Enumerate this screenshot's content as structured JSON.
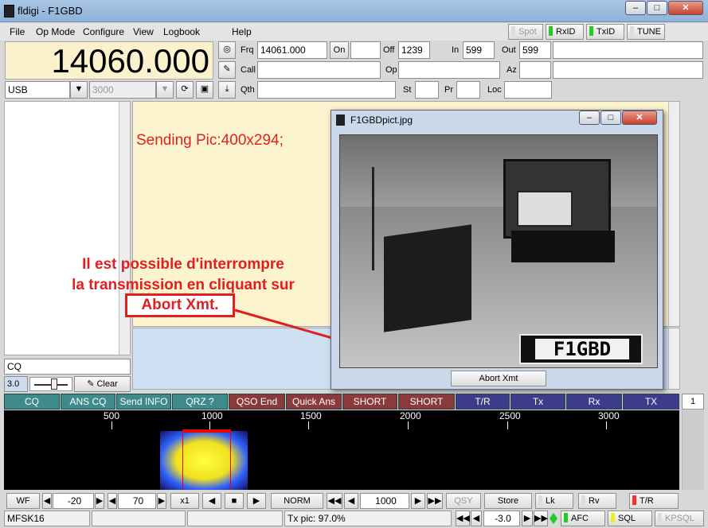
{
  "window": {
    "title": "fldigi - F1GBD"
  },
  "menu": {
    "file": "File",
    "opmode": "Op Mode",
    "configure": "Configure",
    "view": "View",
    "logbook": "Logbook",
    "help": "Help"
  },
  "indicators": {
    "spot": "Spot",
    "rxid": "RxID",
    "txid": "TxID",
    "tune": "TUNE"
  },
  "frequency_display": "14060.000",
  "mode_select": "USB",
  "bandwidth_select": "3000",
  "log": {
    "frq_label": "Frq",
    "frq_value": "14061.000",
    "on_label": "On",
    "off_label": "Off",
    "off_value": "1239",
    "in_label": "In",
    "in_value": "599",
    "out_label": "Out",
    "out_value": "599",
    "call_label": "Call",
    "op_label": "Op",
    "az_label": "Az",
    "qth_label": "Qth",
    "st_label": "St",
    "pr_label": "Pr",
    "loc_label": "Loc"
  },
  "rx_text": "Sending Pic:400x294;",
  "tx_input_left": "CQ",
  "squelch_value": "3.0",
  "clear_button": "Clear",
  "macros": [
    "CQ",
    "ANS CQ",
    "Send INFO",
    "QRZ ?",
    "QSO End",
    "Quick Ans",
    "SHORT ANS",
    "SHORT END",
    "T/R",
    "Tx",
    "Rx",
    "TX"
  ],
  "macro_page": "1",
  "ruler_ticks": [
    "500",
    "1000",
    "1500",
    "2000",
    "2500",
    "3000"
  ],
  "dialog": {
    "title": "F1GBDpict.jpg",
    "abort_button": "Abort Xmt",
    "plate_text": "F1GBD"
  },
  "annotation": {
    "line1": "Il est possible d'interrompre",
    "line2": "la transmission en cliquant sur",
    "line3": "Abort Xmt."
  },
  "wf_controls": {
    "wf": "WF",
    "wf_level": "-20",
    "wf_range": "70",
    "zoom": "x1",
    "norm": "NORM",
    "carrier": "1000",
    "qsy": "QSY",
    "store": "Store",
    "lk": "Lk",
    "rv": "Rv",
    "tr": "T/R"
  },
  "statusbar": {
    "mode": "MFSK16",
    "tx_status": "Tx pic: 97.0%",
    "afc_value": "-3.0",
    "afc": "AFC",
    "sql": "SQL",
    "kpsql": "KPSQL"
  },
  "colors": {
    "macro_teal": "#3f8a8a",
    "macro_maroon": "#8a3a3a",
    "macro_blue": "#3c3c8a",
    "annotation_red": "#e02020"
  }
}
